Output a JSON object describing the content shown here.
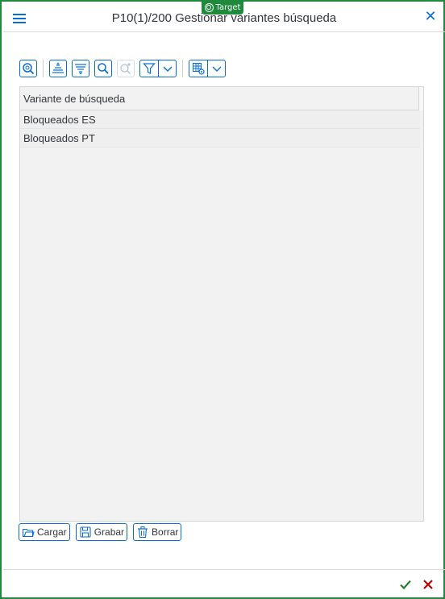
{
  "overlay": {
    "target_label": "Target"
  },
  "dialog": {
    "title": "P10(1)/200 Gestionar variantes búsqueda"
  },
  "toolbar": {
    "buttons": [
      {
        "icon": "zoom-details-icon"
      },
      {
        "icon": "sort-ascending-icon"
      },
      {
        "icon": "sort-descending-icon"
      },
      {
        "icon": "find-icon"
      },
      {
        "icon": "find-next-icon",
        "disabled": true
      },
      {
        "icon": "filter-icon"
      },
      {
        "icon": "layout-settings-icon"
      }
    ]
  },
  "table": {
    "column_header": "Variante de búsqueda",
    "rows": [
      "Bloqueados ES",
      "Bloqueados PT"
    ]
  },
  "actions": {
    "load_label": "Cargar",
    "save_label": "Grabar",
    "delete_label": "Borrar"
  },
  "colors": {
    "accent": "#0a6ed1",
    "frame": "#1f8a3c",
    "confirm": "#2b7c2b",
    "cancel": "#bb0000"
  }
}
